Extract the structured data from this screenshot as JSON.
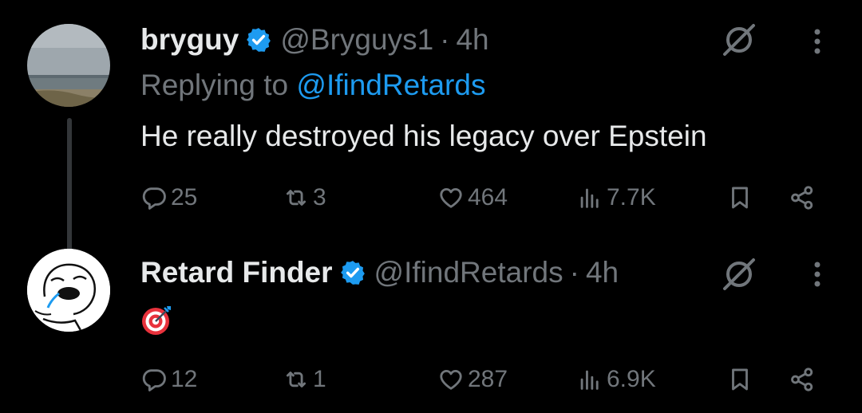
{
  "tweets": [
    {
      "name": "bryguy",
      "handle": "@Bryguys1",
      "separator": "·",
      "time": "4h",
      "replying_prefix": "Replying to ",
      "replying_handle": "@IfindRetards",
      "text": "He really destroyed his legacy over Epstein",
      "replies": "25",
      "retweets": "3",
      "likes": "464",
      "views": "7.7K",
      "avatar_icon": "beach-photo-avatar"
    },
    {
      "name": "Retard Finder",
      "handle": "@IfindRetards",
      "separator": "·",
      "time": "4h",
      "emoji": "🎯",
      "replies": "12",
      "retweets": "1",
      "likes": "287",
      "views": "6.9K",
      "avatar_icon": "meme-face-avatar"
    }
  ],
  "colors": {
    "background": "#000000",
    "text": "#e7e9ea",
    "muted": "#71767b",
    "link": "#1d9bf0",
    "verified": "#1d9bf0"
  }
}
